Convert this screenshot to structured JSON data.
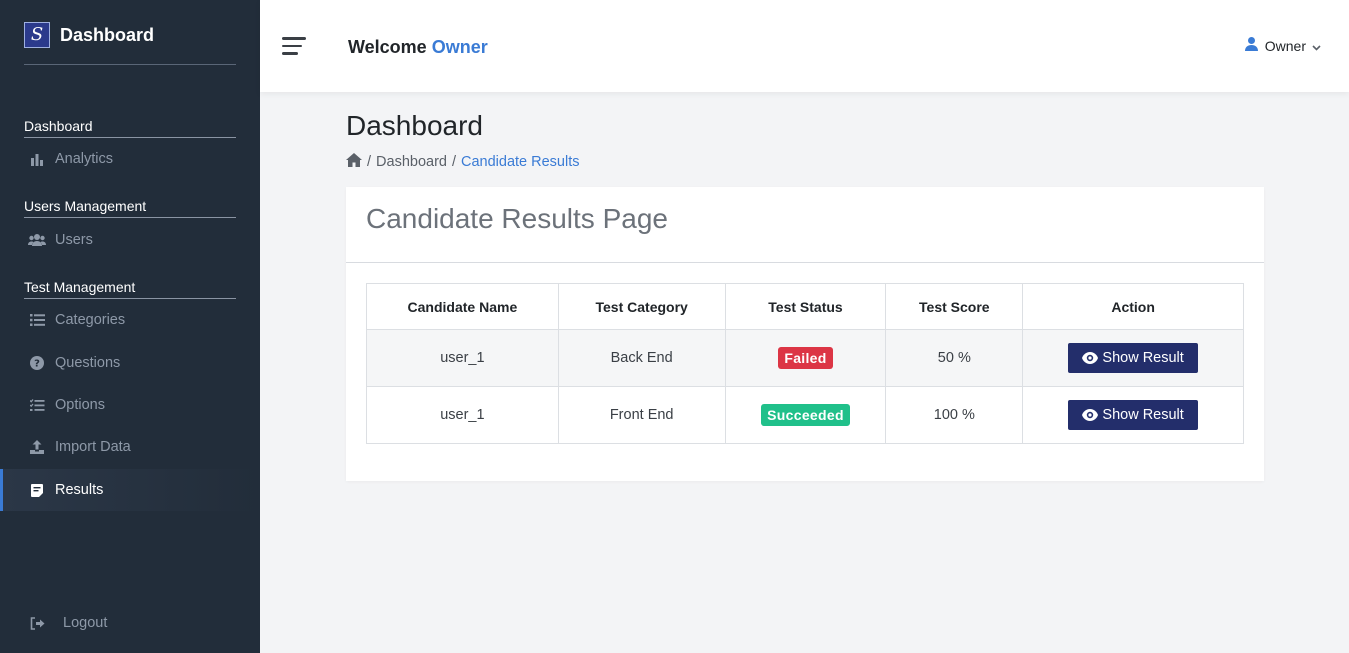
{
  "sidebar": {
    "brand_logo_letter": "S",
    "brand_title": "Dashboard",
    "sections": [
      {
        "heading": "Dashboard",
        "items": [
          {
            "label": "Analytics",
            "icon": "bar-chart-icon"
          }
        ]
      },
      {
        "heading": "Users Management",
        "items": [
          {
            "label": "Users",
            "icon": "users-icon"
          }
        ]
      },
      {
        "heading": "Test Management",
        "items": [
          {
            "label": "Categories",
            "icon": "list-icon"
          },
          {
            "label": "Questions",
            "icon": "question-circle-icon"
          },
          {
            "label": "Options",
            "icon": "checklist-icon"
          },
          {
            "label": "Import Data",
            "icon": "upload-icon"
          },
          {
            "label": "Results",
            "icon": "document-icon",
            "active": true
          }
        ]
      }
    ],
    "logout_label": "Logout"
  },
  "topbar": {
    "welcome_prefix": "Welcome",
    "welcome_name": "Owner",
    "user_name": "Owner"
  },
  "page": {
    "title": "Dashboard",
    "breadcrumb": [
      "Dashboard",
      "Candidate Results"
    ]
  },
  "card": {
    "title": "Candidate Results Page",
    "columns": [
      "Candidate Name",
      "Test Category",
      "Test Status",
      "Test Score",
      "Action"
    ],
    "rows": [
      {
        "name": "user_1",
        "category": "Back End",
        "status": "Failed",
        "status_type": "danger",
        "score": "50 %",
        "action": "Show Result"
      },
      {
        "name": "user_1",
        "category": "Front End",
        "status": "Succeeded",
        "status_type": "success",
        "score": "100 %",
        "action": "Show Result"
      }
    ]
  },
  "colors": {
    "sidebar_bg": "#222d3a",
    "accent": "#3a7bd5",
    "button": "#232e6b",
    "danger": "#dc3545",
    "success": "#20c08a"
  }
}
